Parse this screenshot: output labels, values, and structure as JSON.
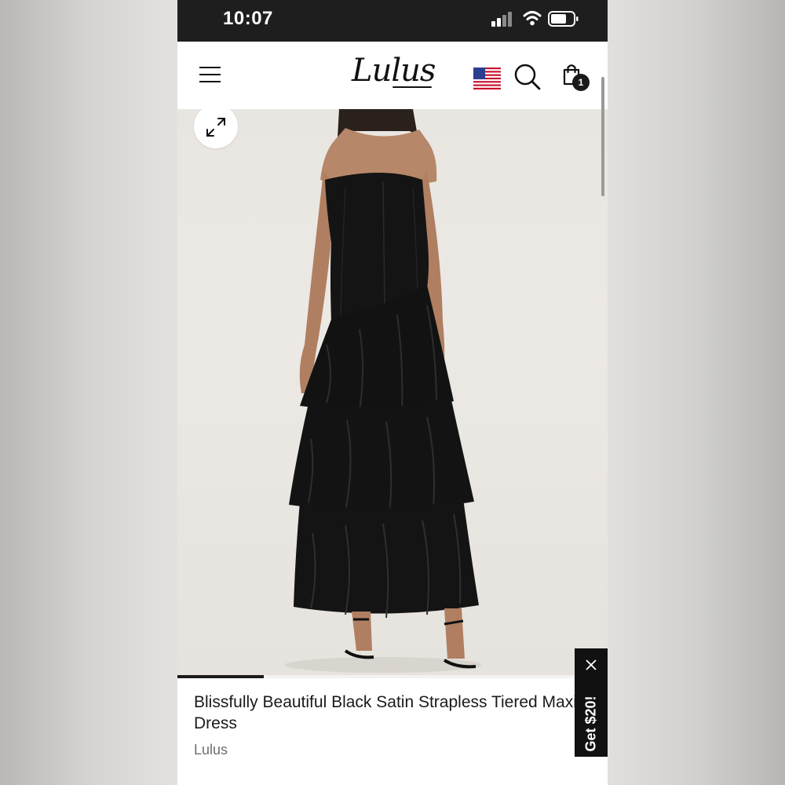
{
  "status_bar": {
    "time": "10:07"
  },
  "header": {
    "logo_text": "Lulus",
    "cart_count": "1",
    "icons": [
      "menu-icon",
      "us-flag-icon",
      "search-icon",
      "shopping-bag-icon"
    ]
  },
  "gallery": {
    "expand_icon": "expand-arrows-icon",
    "progress": 0.2
  },
  "product": {
    "title": "Blissfully Beautiful Black Satin Strapless Tiered Maxi Dress",
    "brand": "Lulus"
  },
  "promo": {
    "label": "Get $20!",
    "close_icon": "close-icon"
  },
  "colors": {
    "status_bar_bg": "#1e1e1e",
    "promo_bg": "#111111",
    "text_primary": "#1a1a1a",
    "text_secondary": "#6f6f6f"
  }
}
